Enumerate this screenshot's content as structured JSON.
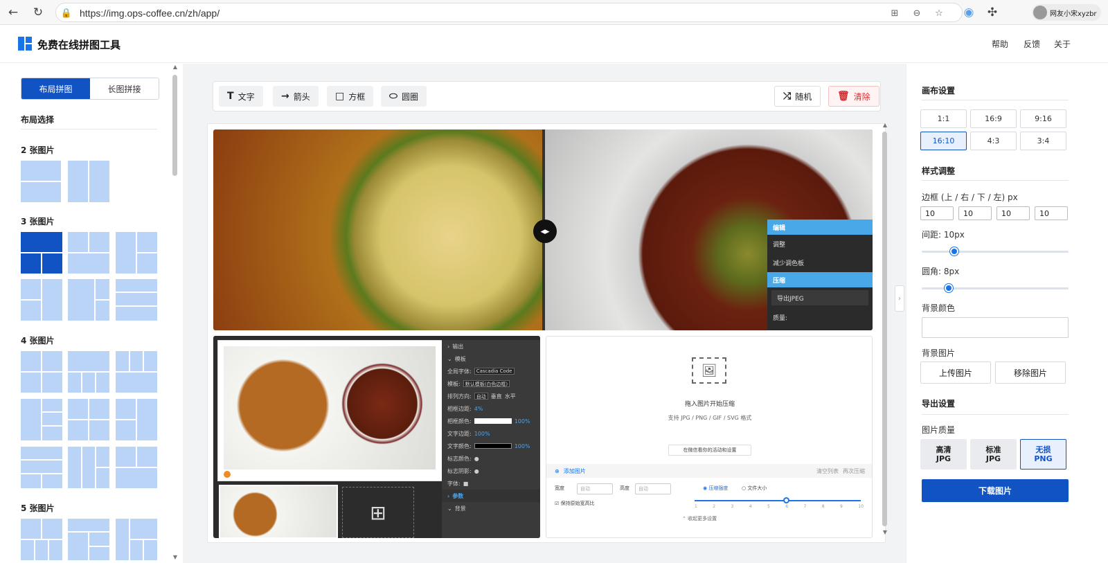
{
  "browser": {
    "url": "https://img.ops-coffee.cn/zh/app/",
    "profile_name": "网友小宋xyzbr"
  },
  "header": {
    "title": "免费在线拼图工具",
    "links": [
      "帮助",
      "反馈",
      "关于"
    ]
  },
  "left": {
    "tabs": [
      "布局拼图",
      "长图拼接"
    ],
    "section_title": "布局选择",
    "groups": [
      "2 张图片",
      "3 张图片",
      "4 张图片",
      "5 张图片"
    ]
  },
  "toolbar": {
    "text": "文字",
    "arrow": "箭头",
    "rect": "方框",
    "circle": "圆圈",
    "random": "随机",
    "clear": "清除"
  },
  "collage": {
    "overlay_menu": [
      "编辑",
      "调整",
      "减少调色板",
      "压缩",
      "导出JPEG",
      "质量:"
    ],
    "editor_side": {
      "rows": [
        "输出",
        "模板",
        "全局字体:",
        "模板:",
        "排列方向:",
        "相框边距:",
        "相框颜色:",
        "文字边距:",
        "文字颜色:",
        "标志颜色:",
        "标志阴影:",
        "字体:",
        "参数",
        "背景"
      ],
      "font": "Cascadia Code",
      "template": "默认模板(白色边框)",
      "dir_options": [
        "自动",
        "垂直",
        "水平"
      ],
      "margin": "4%",
      "opacity": "100%"
    },
    "compress": {
      "drop_title": "拖入图片开始压缩",
      "drop_sub": "支持 JPG / PNG / GIF / SVG 格式",
      "tip": "在微信看你的活动和设置",
      "add": "添加图片",
      "clear_list": "清空列表",
      "recompress": "再次压缩",
      "width_label": "宽度",
      "height_label": "高度",
      "auto": "自动",
      "keep_ratio": "保持原始宽高比",
      "mode_quality": "压缩强度",
      "mode_size": "文件大小",
      "collapse": "收起更多设置",
      "ticks": [
        "1",
        "2",
        "3",
        "4",
        "5",
        "6",
        "7",
        "8",
        "9",
        "10"
      ]
    }
  },
  "right": {
    "canvas_title": "画布设置",
    "ratios": [
      "1:1",
      "16:9",
      "9:16",
      "16:10",
      "4:3",
      "3:4"
    ],
    "ratio_selected": "16:10",
    "style_title": "样式调整",
    "border_label": "边框 (上 / 右 / 下 / 左) px",
    "border_values": [
      "10",
      "10",
      "10",
      "10"
    ],
    "gap_label": "间距: 10px",
    "gap_value": 10,
    "radius_label": "圆角: 8px",
    "radius_value": 8,
    "bg_color_label": "背景颜色",
    "bg_image_label": "背景图片",
    "upload_bg": "上传图片",
    "remove_bg": "移除图片",
    "export_title": "导出设置",
    "quality_label": "图片质量",
    "quality": [
      {
        "line1": "高清",
        "line2": "JPG"
      },
      {
        "line1": "标准",
        "line2": "JPG"
      },
      {
        "line1": "无损",
        "line2": "PNG"
      }
    ],
    "quality_selected": "无损 PNG",
    "download": "下载图片"
  },
  "colors": {
    "accent": "#1253c4",
    "thumb": "#b9d4f6",
    "danger": "#d32f2f"
  }
}
